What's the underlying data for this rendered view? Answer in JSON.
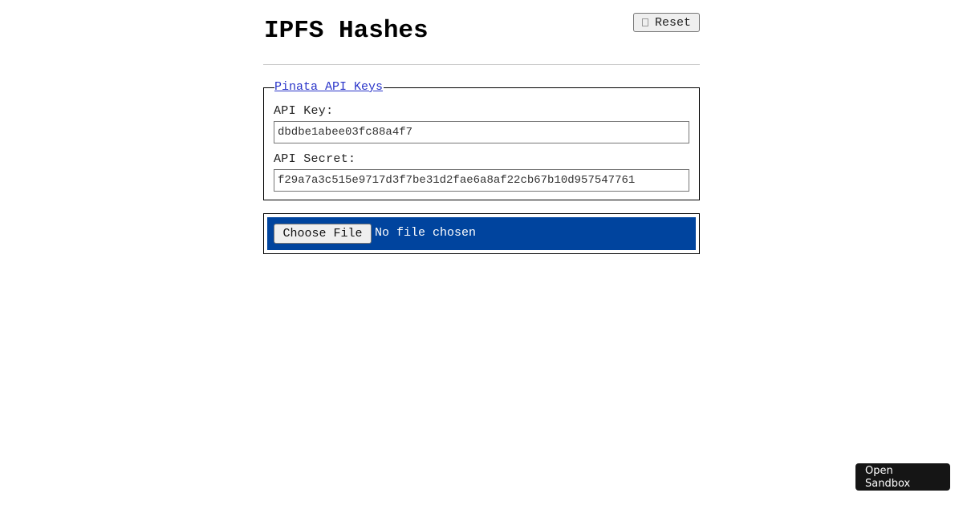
{
  "header": {
    "title": "IPFS Hashes",
    "reset_label": "Reset",
    "reset_icon": "square-icon"
  },
  "keys": {
    "legend": "Pinata API Keys",
    "api_key_label": "API Key:",
    "api_key_value": "dbdbe1abee03fc88a4f7",
    "api_secret_label": "API Secret:",
    "api_secret_value": "f29a7a3c515e9717d3f7be31d2fae6a8af22cb67b10d957547761"
  },
  "upload": {
    "choose_label": "Choose File",
    "status": "No file chosen",
    "background_color": "#00449e"
  },
  "sandbox": {
    "label": "Open Sandbox"
  }
}
